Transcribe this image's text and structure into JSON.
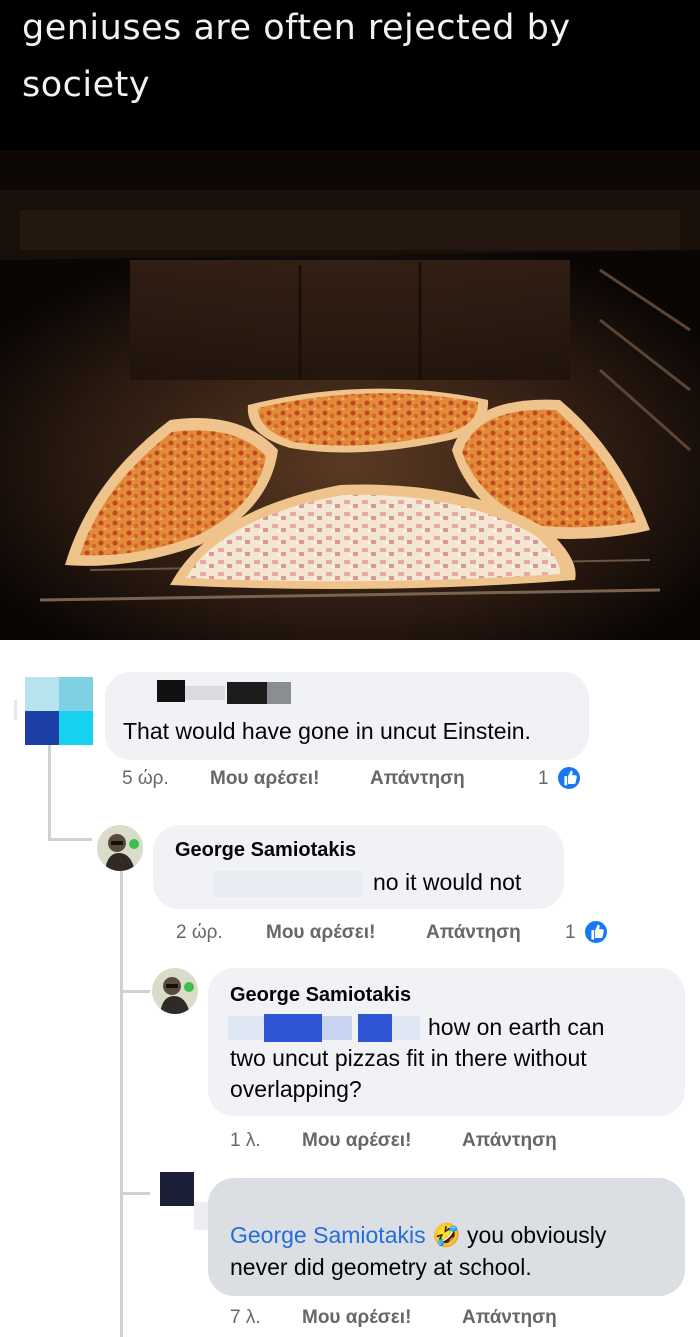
{
  "meme": {
    "caption": "geniuses are often rejected by society"
  },
  "comments": [
    {
      "author": "",
      "text": "That would have gone in uncut Einstein.",
      "time": "5 ώρ.",
      "like_label": "Μου αρέσει!",
      "reply_label": "Απάντηση",
      "reaction_count": "1"
    },
    {
      "author": "George Samiotakis",
      "text": "no it would not",
      "time": "2 ώρ.",
      "like_label": "Μου αρέσει!",
      "reply_label": "Απάντηση",
      "reaction_count": "1"
    },
    {
      "author": "George Samiotakis",
      "text_line1": "how on earth can",
      "text_line2": "two uncut pizzas fit in there without",
      "text_line3": "overlapping?",
      "time": "1 λ.",
      "like_label": "Μου αρέσει!",
      "reply_label": "Απάντηση"
    },
    {
      "mention": "George Samiotakis",
      "emoji": "🤣",
      "text_line1": "you obviously",
      "text_line2": "never did geometry at school.",
      "time": "7 λ.",
      "like_label": "Μου αρέσει!",
      "reply_label": "Απάντηση"
    }
  ],
  "colors": {
    "bubble": "#f0f2f5",
    "meta_text": "#65676b",
    "mention": "#216fdb",
    "like_badge": "#1877f2",
    "thread_line": "#ced0d4"
  },
  "icons": [
    "like-thumb-icon",
    "rolling-laughing-emoji"
  ]
}
